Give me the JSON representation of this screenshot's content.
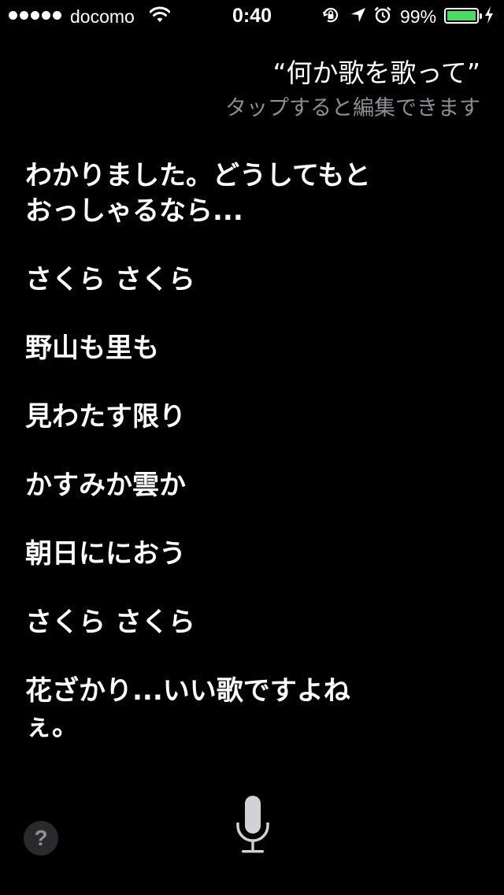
{
  "status_bar": {
    "carrier": "docomo",
    "time": "0:40",
    "battery_percent_text": "99%",
    "battery_level": 0.99,
    "battery_color": "#4cd964",
    "signal_bars": 5,
    "icons": [
      "wifi-icon",
      "rotation-lock-icon",
      "location-arrow-icon",
      "alarm-clock-icon",
      "battery-icon",
      "charging-bolt-icon"
    ]
  },
  "query": {
    "text": "“何か歌を歌って”",
    "edit_hint": "タップすると編集できます"
  },
  "response": {
    "lines": [
      "わかりました。どうしてもと",
      "おっしゃるなら...",
      "さくら さくら",
      "野山も里も",
      "見わたす限り",
      "かすみか雲か",
      "朝日ににおう",
      "さくら さくら",
      "花ざかり...いい歌ですよね",
      "ぇ。"
    ]
  },
  "controls": {
    "help_label": "?",
    "mic_icon": "microphone-icon",
    "mic_color": "#d1d1d6"
  }
}
